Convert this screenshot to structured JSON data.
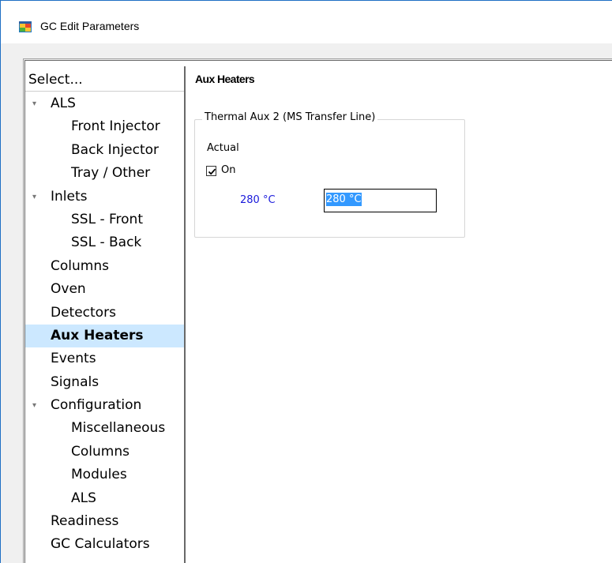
{
  "window": {
    "title": "GC Edit Parameters"
  },
  "nav": {
    "header": "Select...",
    "items": [
      {
        "label": "ALS",
        "level": 0,
        "expandable": true,
        "selected": false
      },
      {
        "label": "Front Injector",
        "level": 1,
        "expandable": false,
        "selected": false
      },
      {
        "label": "Back Injector",
        "level": 1,
        "expandable": false,
        "selected": false
      },
      {
        "label": "Tray / Other",
        "level": 1,
        "expandable": false,
        "selected": false
      },
      {
        "label": "Inlets",
        "level": 0,
        "expandable": true,
        "selected": false
      },
      {
        "label": "SSL - Front",
        "level": 1,
        "expandable": false,
        "selected": false
      },
      {
        "label": "SSL - Back",
        "level": 1,
        "expandable": false,
        "selected": false
      },
      {
        "label": "Columns",
        "level": 0,
        "expandable": false,
        "selected": false
      },
      {
        "label": "Oven",
        "level": 0,
        "expandable": false,
        "selected": false
      },
      {
        "label": "Detectors",
        "level": 0,
        "expandable": false,
        "selected": false
      },
      {
        "label": "Aux Heaters",
        "level": 0,
        "expandable": false,
        "selected": true
      },
      {
        "label": "Events",
        "level": 0,
        "expandable": false,
        "selected": false
      },
      {
        "label": "Signals",
        "level": 0,
        "expandable": false,
        "selected": false
      },
      {
        "label": "Configuration",
        "level": 0,
        "expandable": true,
        "selected": false
      },
      {
        "label": "Miscellaneous",
        "level": 1,
        "expandable": false,
        "selected": false
      },
      {
        "label": "Columns",
        "level": 1,
        "expandable": false,
        "selected": false
      },
      {
        "label": "Modules",
        "level": 1,
        "expandable": false,
        "selected": false
      },
      {
        "label": "ALS",
        "level": 1,
        "expandable": false,
        "selected": false
      },
      {
        "label": "Readiness",
        "level": 0,
        "expandable": false,
        "selected": false
      },
      {
        "label": "GC Calculators",
        "level": 0,
        "expandable": false,
        "selected": false
      }
    ]
  },
  "panel": {
    "title": "Aux Heaters",
    "group": {
      "legend": "Thermal Aux 2 (MS Transfer Line)",
      "actual_label": "Actual",
      "checkbox_label": "On",
      "checkbox_checked": true,
      "actual_value": "280 °C",
      "setpoint_value": "280 °C"
    }
  },
  "colors": {
    "selection": "#cce8ff",
    "actual_value_text": "#1a1adb",
    "input_highlight": "#3399ff",
    "window_border": "#1f6fc4"
  },
  "icons": {
    "app": "window-app-icon",
    "expander": "tree-expander-icon",
    "check": "checkmark-icon"
  }
}
